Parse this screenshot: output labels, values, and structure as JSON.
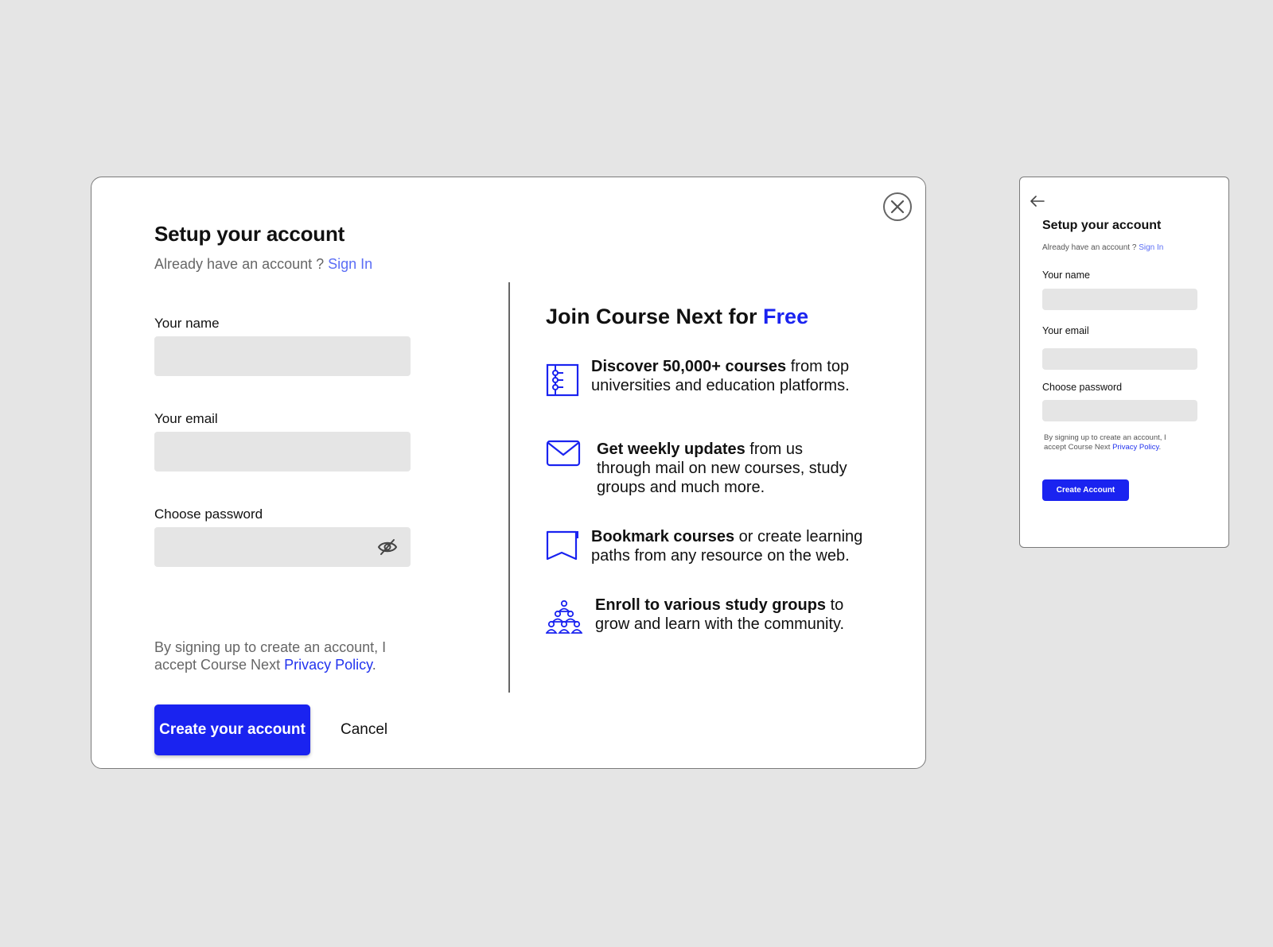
{
  "desktop": {
    "title": "Setup your account",
    "subtitle_prefix": "Already have an account ? ",
    "signin_link": "Sign In",
    "fields": {
      "name_label": "Your name",
      "email_label": "Your email",
      "password_label": "Choose password"
    },
    "policy_prefix": "By signing up to create an account, I accept Course Next ",
    "policy_link": "Privacy Policy",
    "policy_suffix": ".",
    "create_button": "Create your account",
    "cancel_button": "Cancel",
    "right_title_prefix": "Join Course Next for ",
    "right_title_highlight": "Free",
    "features": [
      {
        "bold": "Discover 50,000+ courses",
        "rest": " from top universities and education platforms.",
        "icon": "courses-list-icon"
      },
      {
        "bold": "Get weekly updates",
        "rest": " from us through mail on new courses, study groups and much more.",
        "icon": "mail-icon"
      },
      {
        "bold": "Bookmark courses",
        "rest": " or create learning paths from any resource on the web.",
        "icon": "bookmark-icon"
      },
      {
        "bold": "Enroll to various study groups",
        "rest": " to grow and learn with the community.",
        "icon": "group-icon"
      }
    ]
  },
  "mobile": {
    "title": "Setup your account",
    "subtitle_prefix": "Already have an account ? ",
    "signin_link": "Sign In",
    "name_label": "Your name",
    "email_label": "Your email",
    "password_label": "Choose password",
    "policy_prefix": "By signing up to create an account, I accept Course Next ",
    "policy_link": "Privacy Policy",
    "policy_suffix": ".",
    "create_button": "Create Account"
  },
  "colors": {
    "accent": "#1a23f0",
    "link": "#5b6ef5",
    "field_bg": "#e5e5e5",
    "page_bg": "#e5e5e5"
  }
}
